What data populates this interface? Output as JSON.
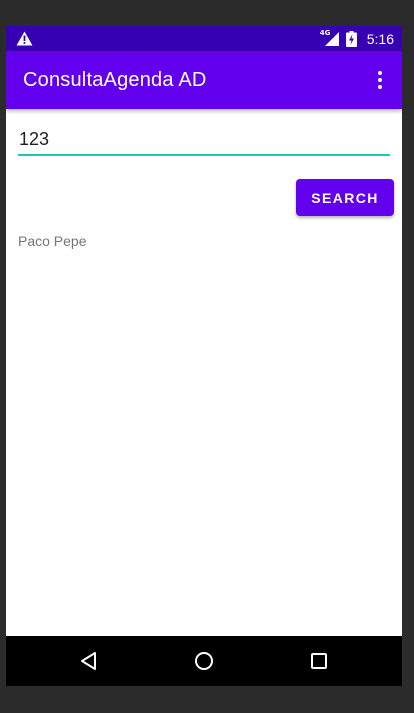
{
  "status_bar": {
    "network_label": "4G",
    "time": "5:16",
    "background": "#3700b3",
    "icons": [
      "warning-icon",
      "signal-icon",
      "battery-icon"
    ]
  },
  "app_bar": {
    "title": "ConsultaAgenda AD",
    "background": "#6200ee",
    "menu_icon": "more-vert-icon"
  },
  "search": {
    "input_value": "123",
    "underline_color": "#1cc9b5",
    "button_label": "SEARCH"
  },
  "result": {
    "text": "Paco Pepe"
  },
  "nav_bar": {
    "buttons": [
      "back-icon",
      "home-icon",
      "recents-icon"
    ]
  }
}
